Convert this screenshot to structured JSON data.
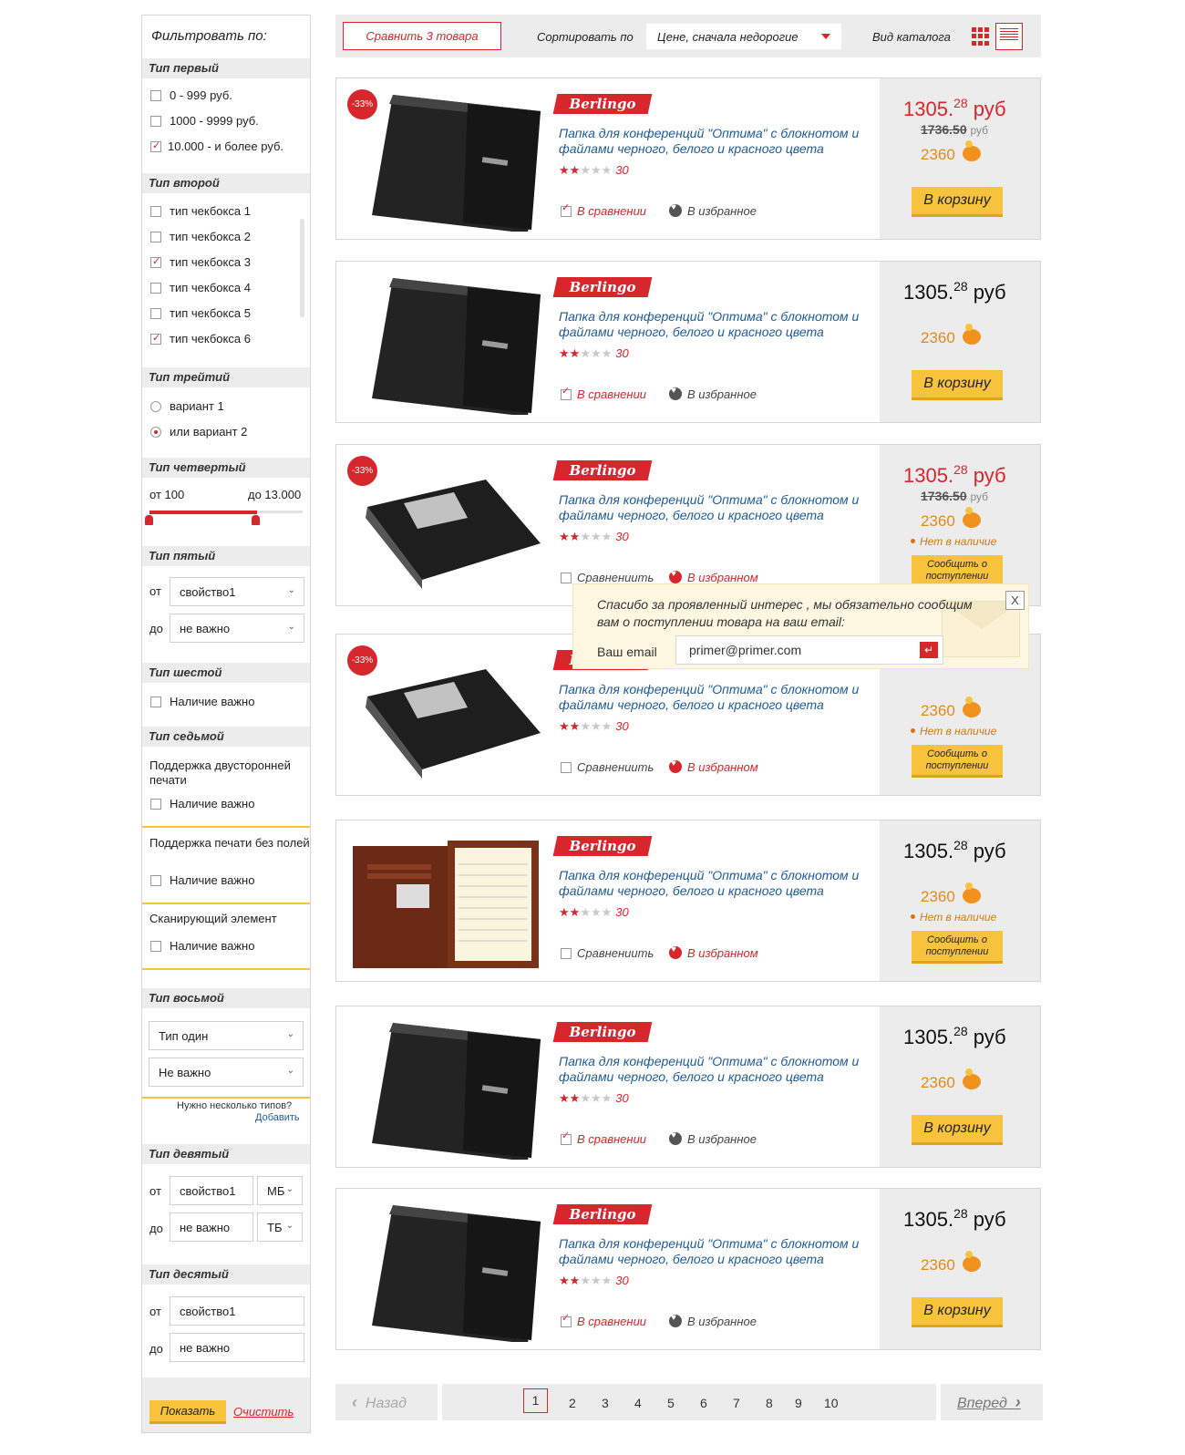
{
  "sidebar": {
    "title": "Фильтровать по:",
    "group1": {
      "title": "Тип первый",
      "options": [
        {
          "label": "0 - 999 руб.",
          "checked": false
        },
        {
          "label": "1000 - 9999 руб.",
          "checked": false
        },
        {
          "label": "10.000 - и более руб.",
          "checked": true
        }
      ]
    },
    "group2": {
      "title": "Тип второй",
      "options": [
        {
          "label": "тип чекбокса 1",
          "checked": false
        },
        {
          "label": "тип чекбокса 2",
          "checked": false
        },
        {
          "label": "тип чекбокса 3",
          "checked": true
        },
        {
          "label": "тип чекбокса 4",
          "checked": false
        },
        {
          "label": "тип чекбокса 5",
          "checked": false
        },
        {
          "label": "тип чекбокса 6",
          "checked": true
        }
      ]
    },
    "group3": {
      "title": "Тип трейтий",
      "options": [
        {
          "label": "вариант 1",
          "selected": false
        },
        {
          "label": "или вариант 2",
          "selected": true
        }
      ]
    },
    "group4": {
      "title": "Тип четвертый",
      "from": "от 100",
      "to": "до 13.000",
      "range": [
        0.0,
        0.75
      ]
    },
    "group5": {
      "title": "Тип пятый",
      "from_label": "от",
      "to_label": "до",
      "from_value": "свойство1",
      "to_value": "не важно"
    },
    "group6": {
      "title": "Тип шестой",
      "check": "Наличие важно"
    },
    "group7": {
      "title": "Тип седьмой",
      "items": [
        {
          "label": "Поддержка двусторонней печати",
          "check": "Наличие важно"
        },
        {
          "label": "Поддержка печати без полей",
          "check": "Наличие важно"
        },
        {
          "label": "Сканирующий элемент",
          "check": "Наличие важно"
        }
      ]
    },
    "group8": {
      "title": "Тип восьмой",
      "select1": "Тип один",
      "select2": "Не важно",
      "hint": "Нужно несколько типов?",
      "add": "Добавить"
    },
    "group9": {
      "title": "Тип девятый",
      "from_label": "от",
      "to_label": "до",
      "from_value": "свойство1",
      "to_value": "не важно",
      "unit1": "МБ",
      "unit2": "ТБ"
    },
    "group10": {
      "title": "Тип десятый",
      "from_label": "от",
      "to_label": "до",
      "from_value": "свойство1",
      "to_value": "не важно"
    },
    "show": "Показать",
    "clear": "Очистить"
  },
  "toolbar": {
    "compare": "Сравнить  3 товара",
    "sort_label": "Сортировать по",
    "sort_value": "Цене, сначала недорогие",
    "view_label": "Вид каталога"
  },
  "products": [
    {
      "discount": "-33%",
      "brand": "Berlingo",
      "name": "Папка для конференций \"Оптима\" с блокнотом и файлами черного, белого и красного цвета",
      "rating": 2,
      "reviews": "30",
      "compare": "В сравнении",
      "favorite": "В избранное",
      "price": "1305.",
      "cents": "28",
      "currency": "руб",
      "old_price": "1736.50",
      "old_currency": "руб",
      "bonus": "2360",
      "cart": "В корзину"
    },
    {
      "brand": "Berlingo",
      "name": "Папка для конференций \"Оптима\" с блокнотом и файлами черного, белого и красного цвета",
      "rating": 2,
      "reviews": "30",
      "compare": "В сравнении",
      "favorite": "В избранное",
      "price": "1305.",
      "cents": "28",
      "currency": "руб",
      "bonus": "2360",
      "cart": "В корзину"
    },
    {
      "discount": "-33%",
      "brand": "Berlingo",
      "name": "Папка для конференций \"Оптима\" с блокнотом и файлами черного, белого и красного цвета",
      "rating": 2,
      "reviews": "30",
      "compare": "Сравнениить",
      "favorite": "В избранном",
      "price": "1305.",
      "cents": "28",
      "currency": "руб",
      "old_price": "1736.50",
      "old_currency": "руб",
      "bonus": "2360",
      "availability": "Нет в наличие",
      "notify": "Сообщить о поступлении"
    },
    {
      "discount": "-33%",
      "brand": "Berlingo",
      "name": "Папка для конференций \"Оптима\" с блокнотом и файлами черного, белого и красного цвета",
      "rating": 2,
      "reviews": "30",
      "compare": "Сравнениить",
      "favorite": "В избранном",
      "bonus": "2360",
      "availability": "Нет в наличие",
      "notify": "Сообщить о поступлении"
    },
    {
      "brand": "Berlingo",
      "name": "Папка для конференций \"Оптима\" с блокнотом и файлами черного, белого и красного цвета",
      "rating": 2,
      "reviews": "30",
      "compare": "Сравнениить",
      "favorite": "В избранном",
      "price": "1305.",
      "cents": "28",
      "currency": "руб",
      "bonus": "2360",
      "availability": "Нет в наличие",
      "notify": "Сообщить о поступлении"
    },
    {
      "brand": "Berlingo",
      "name": "Папка для конференций \"Оптима\" с блокнотом и файлами черного, белого и красного цвета",
      "rating": 2,
      "reviews": "30",
      "compare": "В сравнении",
      "favorite": "В избранное",
      "price": "1305.",
      "cents": "28",
      "currency": "руб",
      "bonus": "2360",
      "cart": "В корзину"
    },
    {
      "brand": "Berlingo",
      "name": "Папка для конференций \"Оптима\" с блокнотом и файлами черного, белого и красного цвета",
      "rating": 2,
      "reviews": "30",
      "compare": "В сравнении",
      "favorite": "В избранное",
      "price": "1305.",
      "cents": "28",
      "currency": "руб",
      "bonus": "2360",
      "cart": "В корзину"
    }
  ],
  "popup": {
    "text": "Спасибо за проявленный интерес , мы обязательно сообщим вам о поступлении товара на ваш email:",
    "email_label": "Ваш email",
    "email_value": "primer@primer.com",
    "close": "X"
  },
  "pagination": {
    "back": "Назад",
    "next": "Вперед",
    "pages": [
      "1",
      "2",
      "3",
      "4",
      "5",
      "6",
      "7",
      "8",
      "9",
      "10"
    ],
    "current": "1"
  },
  "colors": {
    "accent": "#d8262d",
    "button": "#f8c33c",
    "link": "#1d5b9c",
    "bonus": "#e48a1a",
    "panel": "#ececec"
  }
}
